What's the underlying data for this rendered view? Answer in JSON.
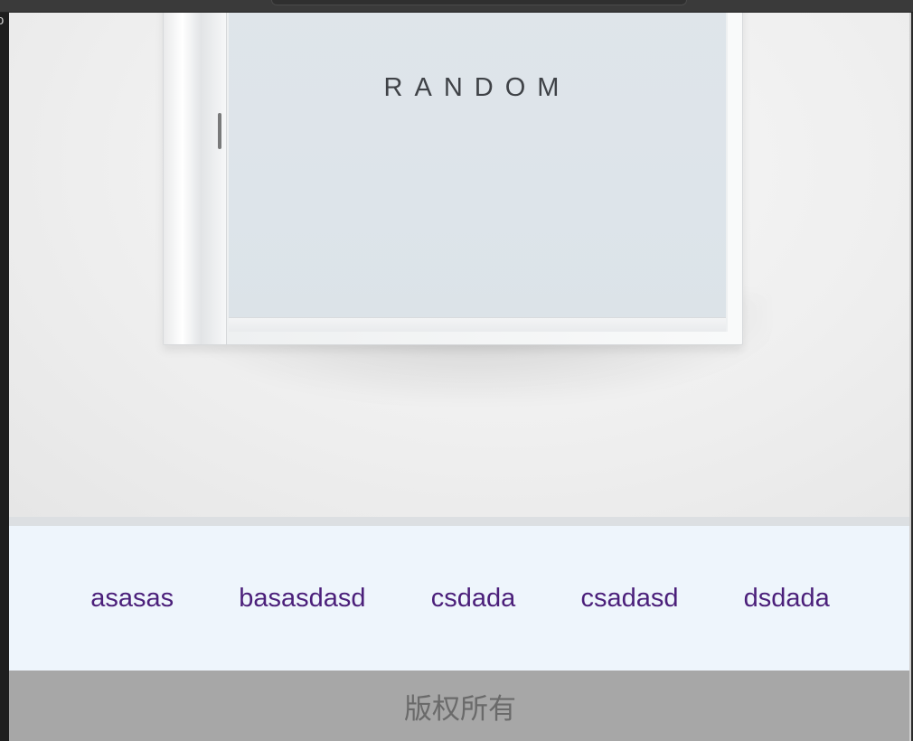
{
  "window": {
    "left_clip_glyph": "o"
  },
  "hero": {
    "image": {
      "title_text": "RANDOM"
    }
  },
  "nav": {
    "items": [
      {
        "label": "asasas"
      },
      {
        "label": "basasdasd"
      },
      {
        "label": "csdada"
      },
      {
        "label": "csadasd"
      },
      {
        "label": "dsdada"
      }
    ]
  },
  "footer": {
    "text": "版权所有"
  },
  "colors": {
    "nav_background": "#eef5fc",
    "nav_link": "#4b1f7a",
    "footer_background": "#a7a7a7",
    "footer_text": "#6a6a6a"
  }
}
